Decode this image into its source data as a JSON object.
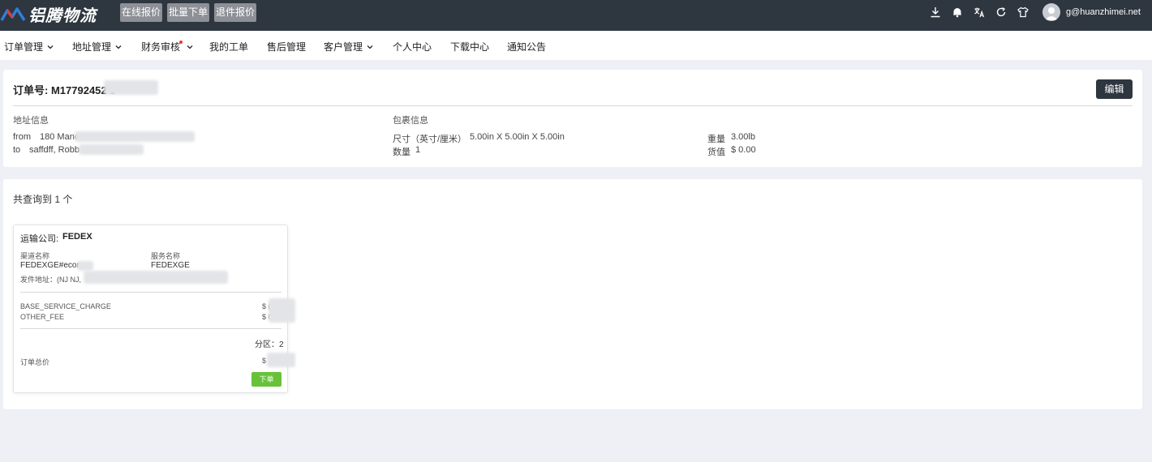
{
  "brand": {
    "name": "铝腾物流"
  },
  "header": {
    "buttons": [
      "在线报价",
      "批量下单",
      "退件报价"
    ],
    "user_email": "g@huanzhimei.net",
    "icons": [
      "download-icon",
      "bell-icon",
      "translate-icon",
      "refresh-icon",
      "shirt-icon"
    ]
  },
  "nav": [
    "订单管理",
    "地址管理",
    "财务审核",
    "我的工单",
    "售后管理",
    "客户管理",
    "个人中心",
    "下载中心",
    "通知公告"
  ],
  "order": {
    "title_prefix": "订单号:",
    "number": "M17792452 5",
    "edit_label": "编辑",
    "address_title": "地址信息",
    "from_label": "from",
    "from_value": "180 Mane",
    "to_label": "to",
    "to_value": "saffdff, Robb",
    "package_title": "包裹信息",
    "size_label": "尺寸（英寸/厘米）",
    "size_value": "5.00in X 5.00in X 5.00in",
    "qty_label": "数量",
    "qty_value": "1",
    "weight_label": "重量",
    "weight_value": "3.00lb",
    "value_label": "货值",
    "value_value": "$ 0.00"
  },
  "results": {
    "summary": "共查询到 1 个",
    "card": {
      "carrier_label": "运输公司:",
      "carrier": "FEDEX",
      "channel_label": "渠道名称",
      "channel_value": "FEDEXGE#econ",
      "service_label": "服务名称",
      "service_value": "FEDEXGE",
      "ship_from": "发件地址：(NJ NJ,",
      "fee1_label": "BASE_SERVICE_CHARGE",
      "fee1_value": "$ (",
      "fee2_label": "OTHER_FEE",
      "fee2_value": "$ 0.",
      "zone": "分区：2",
      "total_label": "订单总价",
      "total_value": "$",
      "order_button": "下单"
    }
  }
}
